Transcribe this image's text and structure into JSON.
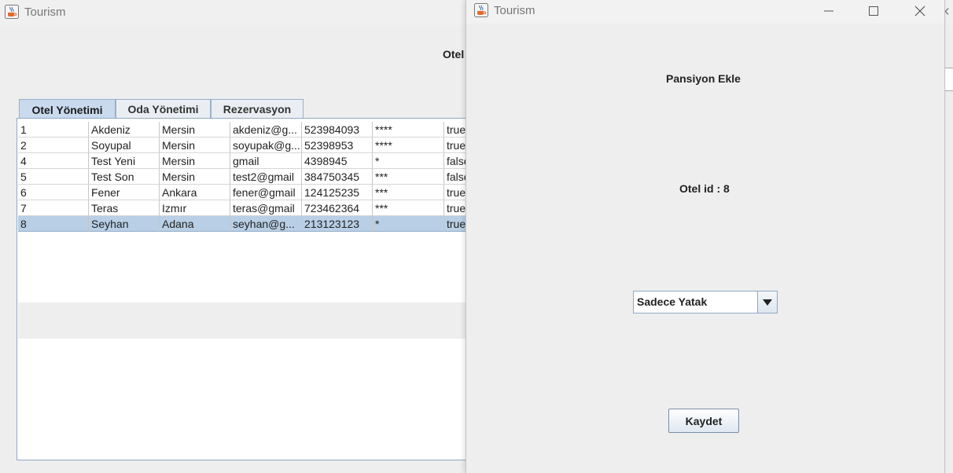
{
  "back_window": {
    "title": "Tourism",
    "header_fragment": "Otel",
    "tabs": [
      "Otel Yönetimi",
      "Oda Yönetimi",
      "Rezervasyon"
    ],
    "active_tab": "Otel Yönetimi",
    "table_rows": [
      [
        "1",
        "Akdeniz",
        "Mersin",
        "akdeniz@g...",
        "523984093",
        "****",
        "true"
      ],
      [
        "2",
        "Soyupal",
        "Mersin",
        "soyupak@g...",
        "52398953",
        "****",
        "true"
      ],
      [
        "4",
        "Test Yeni",
        "Mersin",
        "gmail",
        "4398945",
        "*",
        "false"
      ],
      [
        "5",
        "Test Son",
        "Mersin",
        "test2@gmail",
        "384750345",
        "***",
        "false"
      ],
      [
        "6",
        "Fener",
        "Ankara",
        "fener@gmail",
        "124125235",
        "***",
        "true"
      ],
      [
        "7",
        "Teras",
        "Izmır",
        "teras@gmail",
        "723462364",
        "***",
        "true"
      ],
      [
        "8",
        "Seyhan",
        "Adana",
        "seyhan@g...",
        "213123123",
        "*",
        "true"
      ]
    ],
    "selected_row": "8"
  },
  "dialog": {
    "title": "Tourism",
    "heading": "Pansiyon Ekle",
    "otel_id_label": "Otel id : 8",
    "combo_value": "Sadece Yatak",
    "save_label": "Kaydet"
  },
  "icons": {
    "app": "java-coffee-icon",
    "minimize": "minimize-icon",
    "maximize": "maximize-icon",
    "close": "close-icon",
    "dropdown": "triangle-down-icon"
  },
  "colors": {
    "selection": "#b8cfe5",
    "tab_active": "#c9daee",
    "border_blue": "#8fa8c4"
  }
}
